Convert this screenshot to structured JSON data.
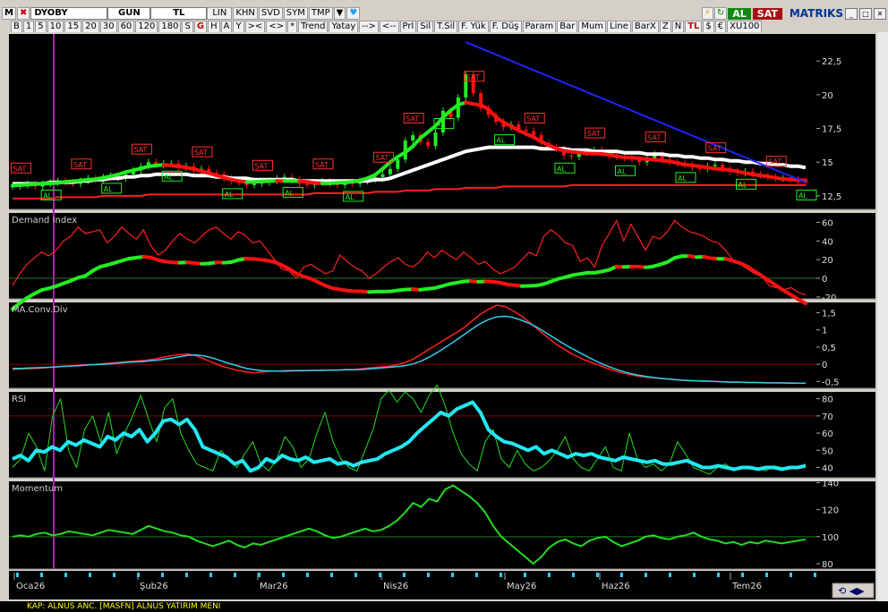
{
  "toolbar1": {
    "app_letter": "M",
    "symbol": "DYOBY",
    "period": "GUN",
    "currency": "TL",
    "scale": "LIN",
    "buttons": [
      "KHN",
      "SVD",
      "SYM",
      "TMP"
    ],
    "al_label": "AL",
    "sat_label": "SAT",
    "brand": "MATRIKS"
  },
  "toolbar2": {
    "items": [
      "B",
      "1",
      "5",
      "10",
      "15",
      "20",
      "30",
      "60",
      "120",
      "180",
      "S",
      "G",
      "H",
      "A",
      "Y",
      "><",
      "<>",
      "*",
      "Trend",
      "Yatay",
      "-->",
      "<--",
      "Prl",
      "Sil",
      "T.Sil",
      "F. Yük",
      "F. Düş",
      "Param",
      "Bar",
      "Mum",
      "Line",
      "BarX",
      "Z",
      "N",
      "TL",
      "$",
      "€",
      "XU100"
    ],
    "red_items": [
      "G",
      "TL"
    ]
  },
  "colors": {
    "background": "#000000",
    "grid_line": "#8b0000",
    "ma_white": "#ffffff",
    "ma_red": "#ff2020",
    "trend_green": "#22ee22",
    "trend_red": "#ff1010",
    "trend_line": "#2222ff",
    "macd_signal": "#33ccee",
    "rsi_thick": "#22e8f0",
    "rsi_thin": "#22dd22",
    "momentum": "#22dd22",
    "sat_box": "#ff3030",
    "al_box": "#22ee22"
  },
  "chart_data": [
    {
      "type": "candlestick",
      "title": "",
      "ylim": [
        11.5,
        24.5
      ],
      "y_ticks": [
        "22,5",
        "20",
        "17,5",
        "15",
        "12,5"
      ],
      "y_tick_values": [
        22.5,
        20,
        17.5,
        15,
        12.5
      ],
      "close": [
        13.2,
        13.3,
        13.4,
        13.2,
        13.4,
        13.5,
        13.6,
        13.5,
        13.4,
        13.6,
        13.8,
        13.7,
        13.9,
        14.0,
        13.8,
        14.1,
        14.4,
        14.7,
        15.0,
        14.8,
        14.9,
        14.9,
        14.6,
        14.7,
        14.4,
        14.5,
        14.2,
        14.1,
        13.8,
        13.6,
        13.5,
        13.3,
        13.4,
        13.5,
        13.6,
        13.8,
        13.9,
        13.7,
        13.4,
        13.3,
        13.5,
        13.6,
        13.4,
        13.3,
        13.5,
        13.4,
        13.6,
        13.7,
        13.9,
        14.1,
        14.5,
        15.2,
        16.6,
        17.0,
        16.5,
        16.2,
        17.2,
        18.8,
        18.3,
        19.8,
        21.5,
        20.1,
        19.0,
        18.5,
        18.0,
        17.6,
        17.8,
        17.4,
        17.3,
        17.0,
        16.4,
        16.1,
        16.0,
        15.5,
        15.4,
        15.7,
        15.8,
        15.9,
        15.7,
        15.5,
        15.4,
        15.3,
        15.2,
        15.0,
        15.3,
        15.6,
        15.2,
        15.0,
        14.9,
        14.8,
        14.6,
        14.5,
        14.7,
        14.8,
        14.5,
        14.3,
        14.2,
        14.3,
        14.1,
        14.0,
        13.9,
        13.8,
        13.8,
        13.7,
        13.6,
        13.5
      ],
      "series": [
        {
          "name": "MA white",
          "values": [
            13.4,
            13.4,
            13.4,
            13.4,
            13.4,
            13.5,
            13.5,
            13.5,
            13.5,
            13.6,
            13.6,
            13.7,
            13.7,
            13.8,
            13.8,
            13.9,
            13.9,
            14.0,
            14.0,
            14.1,
            14.1,
            14.1,
            14.1,
            14.1,
            14.0,
            14.0,
            14.0,
            13.9,
            13.9,
            13.8,
            13.8,
            13.8,
            13.7,
            13.7,
            13.7,
            13.7,
            13.7,
            13.7,
            13.6,
            13.6,
            13.6,
            13.6,
            13.6,
            13.6,
            13.6,
            13.6,
            13.6,
            13.6,
            13.7,
            13.7,
            13.8,
            14.0,
            14.2,
            14.4,
            14.6,
            14.8,
            15.0,
            15.2,
            15.4,
            15.6,
            15.8,
            15.9,
            16.0,
            16.1,
            16.1,
            16.1,
            16.1,
            16.1,
            16.1,
            16.1,
            16.0,
            16.0,
            16.0,
            16.0,
            15.9,
            15.9,
            15.9,
            15.8,
            15.8,
            15.8,
            15.8,
            15.7,
            15.7,
            15.7,
            15.6,
            15.6,
            15.6,
            15.5,
            15.5,
            15.4,
            15.4,
            15.3,
            15.3,
            15.2,
            15.2,
            15.1,
            15.1,
            15.0,
            15.0,
            14.9,
            14.9,
            14.8,
            14.8,
            14.7,
            14.7,
            14.6
          ]
        },
        {
          "name": "MA red",
          "values": [
            12.3,
            12.3,
            12.3,
            12.3,
            12.3,
            12.3,
            12.4,
            12.4,
            12.4,
            12.4,
            12.4,
            12.4,
            12.5,
            12.5,
            12.5,
            12.5,
            12.5,
            12.5,
            12.6,
            12.6,
            12.6,
            12.6,
            12.6,
            12.6,
            12.6,
            12.6,
            12.6,
            12.6,
            12.6,
            12.6,
            12.6,
            12.6,
            12.6,
            12.6,
            12.6,
            12.6,
            12.6,
            12.6,
            12.6,
            12.6,
            12.7,
            12.7,
            12.7,
            12.7,
            12.7,
            12.7,
            12.7,
            12.7,
            12.8,
            12.8,
            12.8,
            12.8,
            12.9,
            12.9,
            12.9,
            12.9,
            13.0,
            13.0,
            13.0,
            13.0,
            13.1,
            13.1,
            13.1,
            13.1,
            13.1,
            13.2,
            13.2,
            13.2,
            13.2,
            13.2,
            13.2,
            13.2,
            13.2,
            13.2,
            13.3,
            13.3,
            13.3,
            13.3,
            13.3,
            13.3,
            13.3,
            13.3,
            13.3,
            13.3,
            13.3,
            13.3,
            13.3,
            13.3,
            13.3,
            13.3,
            13.3,
            13.3,
            13.3,
            13.3,
            13.3,
            13.3,
            13.3,
            13.3,
            13.3,
            13.3,
            13.3,
            13.3,
            13.3,
            13.3,
            13.3,
            13.3
          ]
        }
      ],
      "signal_labels_sat": "SAT",
      "signal_labels_al": "AL",
      "trend_line": {
        "from": [
          60,
          23.9
        ],
        "to": [
          105,
          13.5
        ]
      }
    },
    {
      "type": "line",
      "title": "Demand Index",
      "ylim": [
        -22,
        70
      ],
      "y_ticks": [
        "60",
        "40",
        "20",
        "0",
        "-20"
      ],
      "y_tick_values": [
        60,
        40,
        20,
        0,
        -20
      ],
      "series": [
        {
          "name": "",
          "values": [
            -8,
            5,
            15,
            22,
            28,
            24,
            30,
            40,
            45,
            55,
            48,
            50,
            52,
            38,
            45,
            55,
            48,
            42,
            52,
            35,
            25,
            30,
            40,
            48,
            42,
            38,
            45,
            52,
            55,
            48,
            42,
            50,
            46,
            38,
            40,
            30,
            20,
            10,
            8,
            0,
            12,
            15,
            10,
            5,
            8,
            25,
            18,
            12,
            8,
            0,
            5,
            12,
            18,
            22,
            15,
            12,
            18,
            28,
            22,
            30,
            25,
            20,
            28,
            22,
            15,
            18,
            10,
            5,
            8,
            12,
            20,
            28,
            24,
            45,
            52,
            46,
            38,
            35,
            18,
            22,
            12,
            35,
            48,
            62,
            40,
            58,
            44,
            30,
            45,
            42,
            50,
            62,
            55,
            50,
            48,
            45,
            40,
            38,
            30,
            20,
            15,
            10,
            5,
            2,
            -8,
            -10,
            -12,
            -10,
            -15,
            -18
          ]
        }
      ]
    },
    {
      "type": "line",
      "title": "MA.Conv.Div",
      "ylim": [
        -0.7,
        1.8
      ],
      "y_ticks": [
        "1,5",
        "1",
        "0,5",
        "0",
        "-0,5"
      ],
      "y_tick_values": [
        1.5,
        1,
        0.5,
        0,
        -0.5
      ],
      "series": [
        {
          "name": "",
          "values": [
            -0.15,
            -0.14,
            -0.13,
            -0.12,
            -0.1,
            -0.08,
            -0.07,
            -0.05,
            -0.03,
            -0.01,
            0.0,
            0.02,
            0.04,
            0.06,
            0.08,
            0.1,
            0.12,
            0.15,
            0.2,
            0.25,
            0.28,
            0.3,
            0.25,
            0.15,
            0.05,
            -0.05,
            -0.12,
            -0.18,
            -0.22,
            -0.25,
            -0.22,
            -0.2,
            -0.2,
            -0.18,
            -0.18,
            -0.18,
            -0.18,
            -0.17,
            -0.17,
            -0.17,
            -0.15,
            -0.15,
            -0.12,
            -0.1,
            -0.08,
            -0.06,
            -0.02,
            0.05,
            0.15,
            0.3,
            0.45,
            0.6,
            0.75,
            0.9,
            1.05,
            1.25,
            1.45,
            1.6,
            1.72,
            1.68,
            1.55,
            1.4,
            1.2,
            1.0,
            0.8,
            0.6,
            0.45,
            0.3,
            0.18,
            0.08,
            0.0,
            -0.1,
            -0.18,
            -0.25,
            -0.3,
            -0.35,
            -0.38,
            -0.4,
            -0.42,
            -0.44,
            -0.46,
            -0.48,
            -0.49,
            -0.5,
            -0.5,
            -0.51,
            -0.52,
            -0.52,
            -0.53,
            -0.53,
            -0.53,
            -0.54,
            -0.54,
            -0.54,
            -0.55,
            -0.55
          ]
        },
        {
          "name": "",
          "values": [
            -0.12,
            -0.12,
            -0.11,
            -0.1,
            -0.09,
            -0.08,
            -0.06,
            -0.05,
            -0.04,
            -0.02,
            -0.01,
            0.0,
            0.02,
            0.04,
            0.06,
            0.07,
            0.09,
            0.11,
            0.14,
            0.18,
            0.22,
            0.26,
            0.27,
            0.24,
            0.18,
            0.1,
            0.02,
            -0.05,
            -0.12,
            -0.16,
            -0.19,
            -0.2,
            -0.2,
            -0.2,
            -0.19,
            -0.19,
            -0.18,
            -0.18,
            -0.17,
            -0.17,
            -0.16,
            -0.16,
            -0.15,
            -0.13,
            -0.11,
            -0.09,
            -0.07,
            -0.04,
            0.01,
            0.1,
            0.22,
            0.36,
            0.52,
            0.68,
            0.85,
            1.02,
            1.18,
            1.3,
            1.38,
            1.4,
            1.36,
            1.28,
            1.18,
            1.05,
            0.9,
            0.75,
            0.6,
            0.46,
            0.33,
            0.2,
            0.08,
            -0.03,
            -0.12,
            -0.2,
            -0.27,
            -0.32,
            -0.36,
            -0.39,
            -0.42,
            -0.44,
            -0.46,
            -0.47,
            -0.48,
            -0.49,
            -0.5,
            -0.51,
            -0.52,
            -0.52,
            -0.53,
            -0.53,
            -0.54,
            -0.54,
            -0.54,
            -0.55,
            -0.55,
            -0.55
          ]
        }
      ]
    },
    {
      "type": "line",
      "title": "RSI",
      "ylim": [
        34,
        84
      ],
      "y_ticks": [
        "80",
        "70",
        "60",
        "50",
        "40"
      ],
      "y_tick_values": [
        80,
        70,
        60,
        50,
        40
      ],
      "series": [
        {
          "name": "",
          "values": [
            45,
            47,
            44,
            50,
            49,
            52,
            50,
            55,
            53,
            56,
            54,
            52,
            58,
            56,
            60,
            58,
            62,
            55,
            60,
            67,
            68,
            65,
            68,
            62,
            52,
            50,
            48,
            46,
            42,
            44,
            38,
            40,
            45,
            43,
            47,
            45,
            44,
            46,
            43,
            44,
            45,
            42,
            43,
            41,
            43,
            44,
            45,
            48,
            50,
            52,
            55,
            60,
            64,
            68,
            72,
            70,
            74,
            76,
            78,
            72,
            62,
            58,
            55,
            54,
            52,
            50,
            52,
            48,
            50,
            48,
            46,
            48,
            47,
            48,
            46,
            45,
            44,
            46,
            45,
            44,
            43,
            44,
            42,
            42,
            43,
            44,
            42,
            40,
            40,
            41,
            40,
            39,
            40,
            40,
            39,
            40,
            40,
            39,
            40,
            40,
            41
          ]
        },
        {
          "name": "",
          "values": [
            40,
            45,
            60,
            52,
            38,
            70,
            80,
            50,
            40,
            62,
            70,
            55,
            72,
            48,
            60,
            70,
            82,
            68,
            55,
            75,
            80,
            60,
            50,
            42,
            40,
            38,
            50,
            45,
            40,
            48,
            55,
            42,
            38,
            45,
            58,
            52,
            40,
            45,
            60,
            72,
            55,
            45,
            40,
            38,
            50,
            62,
            80,
            85,
            78,
            84,
            80,
            72,
            82,
            88,
            76,
            60,
            48,
            42,
            38,
            55,
            62,
            45,
            40,
            50,
            42,
            38,
            40,
            44,
            50,
            58,
            45,
            40,
            38,
            45,
            52,
            40,
            38,
            60,
            45,
            40,
            42,
            38,
            42,
            55,
            48,
            40,
            38,
            36,
            40,
            42,
            38,
            40,
            39,
            40,
            38,
            41,
            40,
            39,
            40,
            42
          ]
        }
      ]
    },
    {
      "type": "line",
      "title": "Momentum",
      "ylim": [
        76,
        141
      ],
      "y_ticks": [
        "140",
        "120",
        "100",
        "80"
      ],
      "y_tick_values": [
        140,
        120,
        100,
        80
      ],
      "series": [
        {
          "name": "",
          "values": [
            100,
            101,
            100,
            102,
            103,
            101,
            102,
            104,
            103,
            102,
            101,
            103,
            105,
            104,
            103,
            102,
            105,
            108,
            106,
            104,
            103,
            101,
            100,
            97,
            95,
            93,
            95,
            97,
            94,
            92,
            95,
            94,
            96,
            98,
            100,
            102,
            104,
            106,
            104,
            101,
            99,
            100,
            102,
            104,
            106,
            104,
            105,
            108,
            112,
            118,
            125,
            122,
            128,
            126,
            135,
            138,
            134,
            130,
            125,
            118,
            108,
            100,
            95,
            90,
            85,
            80,
            85,
            92,
            96,
            98,
            95,
            93,
            97,
            99,
            100,
            96,
            93,
            95,
            97,
            100,
            101,
            99,
            98,
            100,
            101,
            103,
            100,
            98,
            97,
            95,
            96,
            94,
            96,
            95,
            97,
            96,
            95,
            96,
            97,
            98
          ]
        }
      ]
    }
  ],
  "x_axis": {
    "labels": [
      "Oca26",
      "Şub26",
      "Mar26",
      "Nis26",
      "May26",
      "Haz26",
      "Tem26"
    ]
  },
  "status_text": "KAP: ALNUS ANC. [MASFN] ALNUS YATIRIM MENI"
}
